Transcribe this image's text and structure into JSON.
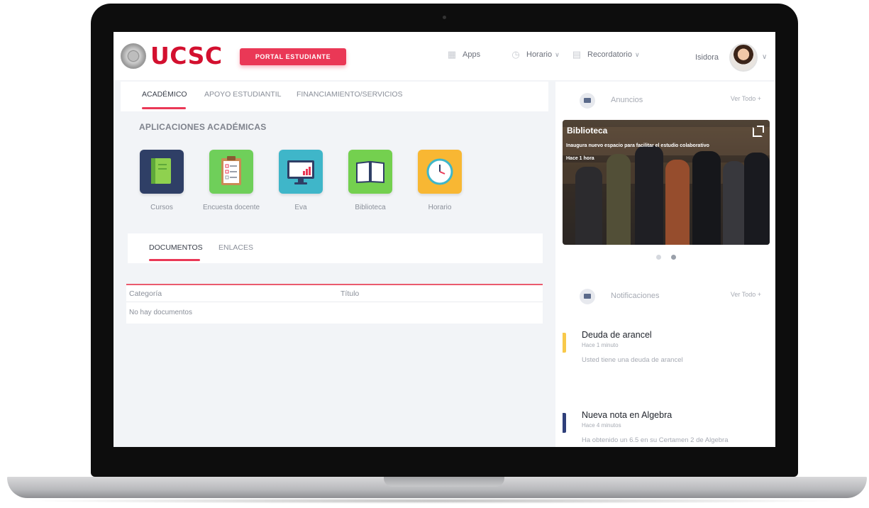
{
  "brand": {
    "logo_text": "UCSC",
    "portal_label": "PORTAL ESTUDIANTE",
    "accent": "#ea3856",
    "logo_color": "#d3102f"
  },
  "topnav": {
    "apps_label": "Apps",
    "horario_label": "Horario",
    "recordatorio_label": "Recordatorio",
    "user_name": "Isidora"
  },
  "main": {
    "tabs": [
      {
        "label": "ACADÉMICO",
        "active": true
      },
      {
        "label": "APOYO ESTUDIANTIL",
        "active": false
      },
      {
        "label": "FINANCIAMIENTO/SERVICIOS",
        "active": false
      }
    ],
    "section_title": "APLICACIONES ACADÉMICAS",
    "apps": [
      {
        "label": "Cursos",
        "icon": "notebook-icon",
        "color": "#2f3f66"
      },
      {
        "label": "Encuesta docente",
        "icon": "clipboard-icon",
        "color": "#6fcf5a"
      },
      {
        "label": "Eva",
        "icon": "monitor-chart-icon",
        "color": "#3fb6c9"
      },
      {
        "label": "Biblioteca",
        "icon": "book-icon",
        "color": "#74d04f"
      },
      {
        "label": "Horario",
        "icon": "clock-icon",
        "color": "#f8b733"
      }
    ],
    "doc_tabs": [
      {
        "label": "DOCUMENTOS",
        "active": true
      },
      {
        "label": "ENLACES",
        "active": false
      }
    ],
    "table": {
      "columns": [
        "Categoría",
        "Título"
      ],
      "empty_text": "No hay documentos"
    }
  },
  "announcements": {
    "title": "Anuncios",
    "view_all": "Ver Todo +",
    "item": {
      "title": "Biblioteca",
      "subtitle": "Inaugura nuevo espacio para facilitar el estudio colaborativo",
      "time": "Hace 1 hora"
    },
    "active_slide": 2,
    "slide_count": 2
  },
  "notifications": {
    "title": "Notificaciones",
    "view_all": "Ver Todo +",
    "items": [
      {
        "title": "Deuda de arancel",
        "time": "Hace 1 minuto",
        "text": "Usted tiene una deuda de arancel",
        "color": "#f8c94a"
      },
      {
        "title": "Nueva nota en Algebra",
        "time": "Hace 4 minutos",
        "text": "Ha obtenido un 6.5 en su Certamen 2 de Algebra",
        "color": "#2f3f7a"
      }
    ]
  }
}
